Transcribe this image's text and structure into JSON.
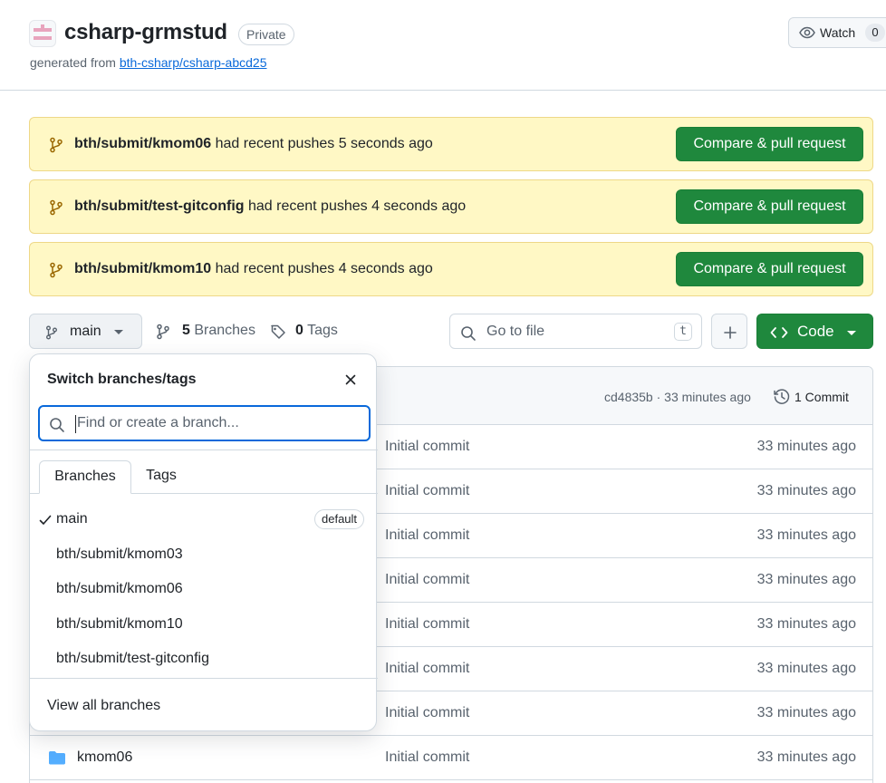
{
  "repo": {
    "name": "csharp-grmstud",
    "visibility": "Private",
    "generated_prefix": "generated from",
    "generated_link": "bth-csharp/csharp-abcd25",
    "watch_label": "Watch",
    "watch_count": "0"
  },
  "banners": [
    {
      "branch": "bth/submit/kmom06",
      "text": "had recent pushes 5 seconds ago",
      "button": "Compare & pull request"
    },
    {
      "branch": "bth/submit/test-gitconfig",
      "text": "had recent pushes 4 seconds ago",
      "button": "Compare & pull request"
    },
    {
      "branch": "bth/submit/kmom10",
      "text": "had recent pushes 4 seconds ago",
      "button": "Compare & pull request"
    }
  ],
  "toolbar": {
    "current_branch": "main",
    "branches_count": "5",
    "branches_label": "Branches",
    "tags_count": "0",
    "tags_label": "Tags",
    "goto_placeholder": "Go to file",
    "goto_shortcut": "t",
    "code_label": "Code"
  },
  "commit_bar": {
    "hash_time": "cd4835b · 33 minutes ago",
    "commits_label": "1 Commit"
  },
  "files": [
    {
      "name": "",
      "message": "Initial commit",
      "time": "33 minutes ago"
    },
    {
      "name": "",
      "message": "Initial commit",
      "time": "33 minutes ago"
    },
    {
      "name": "",
      "message": "Initial commit",
      "time": "33 minutes ago"
    },
    {
      "name": "",
      "message": "Initial commit",
      "time": "33 minutes ago"
    },
    {
      "name": "",
      "message": "Initial commit",
      "time": "33 minutes ago"
    },
    {
      "name": "",
      "message": "Initial commit",
      "time": "33 minutes ago"
    },
    {
      "name": "",
      "message": "Initial commit",
      "time": "33 minutes ago"
    },
    {
      "name": "kmom06",
      "message": "Initial commit",
      "time": "33 minutes ago"
    }
  ],
  "dropdown": {
    "title": "Switch branches/tags",
    "search_placeholder": "Find or create a branch...",
    "tab_branches": "Branches",
    "tab_tags": "Tags",
    "items": [
      {
        "name": "main",
        "badge": "default"
      },
      {
        "name": "bth/submit/kmom03"
      },
      {
        "name": "bth/submit/kmom06"
      },
      {
        "name": "bth/submit/kmom10"
      },
      {
        "name": "bth/submit/test-gitconfig"
      }
    ],
    "view_all": "View all branches"
  },
  "colors": {
    "accent": "#0969da",
    "primary_button": "#1f883d",
    "banner_bg": "#fff8c5",
    "folder": "#54aeff"
  }
}
